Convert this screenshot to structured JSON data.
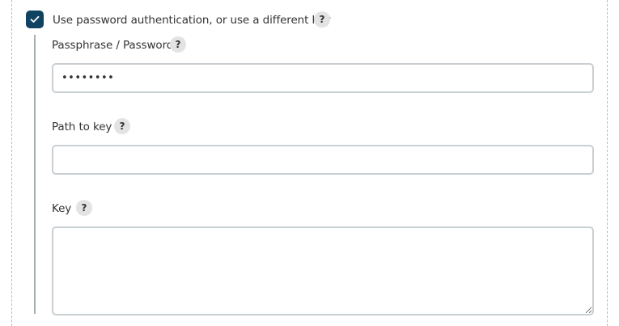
{
  "auth_toggle": {
    "label": "Use password authentication, or use a different key",
    "checked": true,
    "help": "?"
  },
  "passphrase": {
    "label": "Passphrase / Password",
    "help": "?",
    "value": "password"
  },
  "path_to_key": {
    "label": "Path to key",
    "help": "?",
    "value": ""
  },
  "key": {
    "label": "Key",
    "help": "?",
    "value": ""
  },
  "icons": {
    "checkbox": "checkmark-icon",
    "help": "question-mark-icon",
    "resize": "resize-handle-icon"
  },
  "colors": {
    "checkbox_fill": "#0f4361",
    "field_border": "#c9cfd2",
    "help_bg": "#e3e3e3",
    "nest_line": "#a9b0b3"
  }
}
